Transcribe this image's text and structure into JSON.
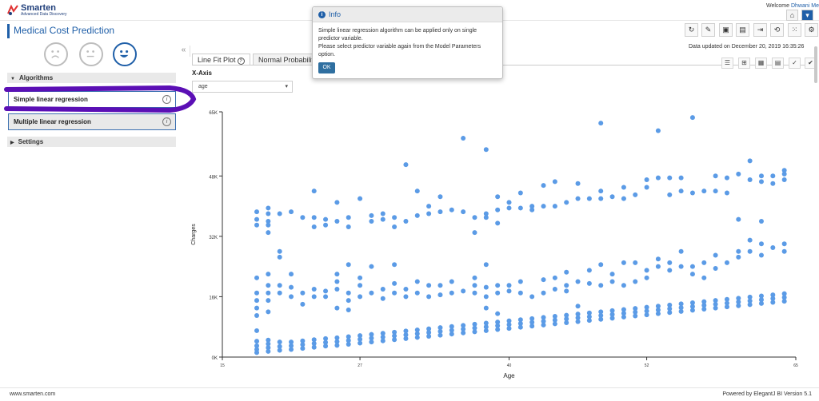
{
  "app": {
    "logo_name": "Smarten",
    "logo_sub": "Advanced Data Discovery",
    "welcome_prefix": "Welcome",
    "welcome_user": "Dhwani Me",
    "page_title": "Medical Cost Prediction",
    "updated": "Data updated on December 20, 2019 16:35:26"
  },
  "icons": {
    "home": "home-icon",
    "toolbar": [
      "refresh-icon",
      "tags-icon",
      "save-icon",
      "save-as-icon",
      "export-icon",
      "edit-icon",
      "time-icon",
      "grid-icon",
      "settings-icon"
    ],
    "mini": [
      "list-icon",
      "columns-icon",
      "table-icon",
      "table-rows-icon",
      "check-icon",
      "check-icon"
    ]
  },
  "sidebar": {
    "collapse_glyph": "«",
    "algorithms_header": "Algorithms",
    "algorithms": [
      "Simple linear regression",
      "Multiple linear regression"
    ],
    "settings_header": "Settings"
  },
  "tabs": [
    "Line Fit Plot",
    "Normal Probability"
  ],
  "controls": {
    "x_axis_label": "X-Axis",
    "x_axis_value": "age"
  },
  "modal": {
    "title": "Info",
    "line1": "Simple linear regression algorithm can be applied only on single predictor variable.",
    "line2": "Please select predictor variable again from the Model Parameters option.",
    "ok": "OK"
  },
  "footer": {
    "left": "www.smarten.com",
    "right": "Powered by ElegantJ BI Version 5.1"
  },
  "colors": {
    "accent": "#1f5fa8",
    "point": "#5b9be6",
    "annotation": "#5b0fb5"
  },
  "chart_data": {
    "type": "scatter",
    "xlabel": "Age",
    "ylabel": "Charges",
    "xlim": [
      15,
      65
    ],
    "ylim": [
      0,
      65000
    ],
    "x_ticks": [
      15,
      27,
      40,
      52,
      65
    ],
    "y_ticks": [
      0,
      16000,
      32000,
      48000,
      65000
    ],
    "x_tick_labels": [
      "15",
      "27",
      "40",
      "52",
      "65"
    ],
    "y_tick_labels": [
      "0K",
      "16K",
      "32K",
      "48K",
      "65K"
    ],
    "grid": false,
    "points": [
      [
        18,
        1200
      ],
      [
        18,
        2000
      ],
      [
        18,
        3000
      ],
      [
        18,
        4200
      ],
      [
        18,
        7000
      ],
      [
        18,
        11000
      ],
      [
        18,
        13000
      ],
      [
        18,
        15000
      ],
      [
        18,
        17000
      ],
      [
        18,
        21000
      ],
      [
        18,
        35000
      ],
      [
        18,
        36500
      ],
      [
        18,
        38500
      ],
      [
        19,
        1500
      ],
      [
        19,
        2500
      ],
      [
        19,
        3500
      ],
      [
        19,
        4500
      ],
      [
        19,
        12000
      ],
      [
        19,
        15000
      ],
      [
        19,
        17000
      ],
      [
        19,
        19000
      ],
      [
        19,
        22000
      ],
      [
        19,
        33000
      ],
      [
        19,
        35000
      ],
      [
        19,
        36000
      ],
      [
        19,
        38000
      ],
      [
        19,
        39500
      ],
      [
        20,
        1800
      ],
      [
        20,
        2800
      ],
      [
        20,
        4000
      ],
      [
        20,
        17000
      ],
      [
        20,
        19000
      ],
      [
        20,
        26500
      ],
      [
        20,
        28000
      ],
      [
        20,
        38000
      ],
      [
        21,
        2000
      ],
      [
        21,
        3000
      ],
      [
        21,
        4000
      ],
      [
        21,
        16000
      ],
      [
        21,
        18500
      ],
      [
        21,
        22000
      ],
      [
        21,
        38500
      ],
      [
        22,
        2300
      ],
      [
        22,
        3300
      ],
      [
        22,
        4300
      ],
      [
        22,
        14000
      ],
      [
        22,
        17000
      ],
      [
        22,
        37000
      ],
      [
        23,
        2600
      ],
      [
        23,
        3600
      ],
      [
        23,
        4600
      ],
      [
        23,
        16000
      ],
      [
        23,
        18000
      ],
      [
        23,
        34500
      ],
      [
        23,
        37000
      ],
      [
        23,
        44000
      ],
      [
        24,
        2900
      ],
      [
        24,
        3900
      ],
      [
        24,
        4900
      ],
      [
        24,
        16000
      ],
      [
        24,
        17500
      ],
      [
        24,
        35000
      ],
      [
        24,
        36500
      ],
      [
        25,
        3100
      ],
      [
        25,
        4100
      ],
      [
        25,
        5100
      ],
      [
        25,
        13000
      ],
      [
        25,
        18000
      ],
      [
        25,
        20000
      ],
      [
        25,
        22000
      ],
      [
        25,
        36000
      ],
      [
        25,
        41000
      ],
      [
        26,
        3400
      ],
      [
        26,
        4400
      ],
      [
        26,
        5400
      ],
      [
        26,
        12500
      ],
      [
        26,
        15000
      ],
      [
        26,
        17000
      ],
      [
        26,
        24500
      ],
      [
        26,
        34500
      ],
      [
        26,
        37000
      ],
      [
        27,
        3700
      ],
      [
        27,
        4700
      ],
      [
        27,
        5700
      ],
      [
        27,
        16000
      ],
      [
        27,
        19000
      ],
      [
        27,
        21000
      ],
      [
        27,
        42000
      ],
      [
        28,
        4000
      ],
      [
        28,
        5000
      ],
      [
        28,
        6000
      ],
      [
        28,
        17000
      ],
      [
        28,
        24000
      ],
      [
        28,
        36000
      ],
      [
        28,
        37500
      ],
      [
        29,
        4300
      ],
      [
        29,
        5300
      ],
      [
        29,
        6300
      ],
      [
        29,
        15500
      ],
      [
        29,
        18000
      ],
      [
        29,
        36500
      ],
      [
        29,
        38000
      ],
      [
        30,
        4600
      ],
      [
        30,
        5600
      ],
      [
        30,
        6600
      ],
      [
        30,
        17000
      ],
      [
        30,
        19500
      ],
      [
        30,
        24500
      ],
      [
        30,
        34500
      ],
      [
        30,
        37000
      ],
      [
        31,
        4900
      ],
      [
        31,
        5900
      ],
      [
        31,
        6900
      ],
      [
        31,
        16000
      ],
      [
        31,
        18000
      ],
      [
        31,
        51000
      ],
      [
        31,
        36000
      ],
      [
        32,
        5200
      ],
      [
        32,
        6200
      ],
      [
        32,
        7200
      ],
      [
        32,
        17000
      ],
      [
        32,
        20000
      ],
      [
        32,
        44000
      ],
      [
        32,
        37500
      ],
      [
        33,
        5500
      ],
      [
        33,
        6500
      ],
      [
        33,
        7500
      ],
      [
        33,
        16000
      ],
      [
        33,
        19000
      ],
      [
        33,
        38000
      ],
      [
        33,
        40000
      ],
      [
        34,
        5800
      ],
      [
        34,
        6800
      ],
      [
        34,
        7800
      ],
      [
        34,
        16500
      ],
      [
        34,
        19000
      ],
      [
        34,
        38500
      ],
      [
        34,
        42500
      ],
      [
        35,
        6100
      ],
      [
        35,
        7100
      ],
      [
        35,
        8100
      ],
      [
        35,
        17000
      ],
      [
        35,
        20000
      ],
      [
        35,
        39000
      ],
      [
        36,
        6400
      ],
      [
        36,
        7400
      ],
      [
        36,
        8400
      ],
      [
        36,
        17500
      ],
      [
        36,
        58000
      ],
      [
        36,
        38500
      ],
      [
        37,
        6700
      ],
      [
        37,
        7700
      ],
      [
        37,
        8700
      ],
      [
        37,
        17000
      ],
      [
        37,
        19000
      ],
      [
        37,
        21000
      ],
      [
        37,
        33000
      ],
      [
        37,
        37000
      ],
      [
        38,
        7000
      ],
      [
        38,
        8000
      ],
      [
        38,
        9000
      ],
      [
        38,
        13000
      ],
      [
        38,
        16000
      ],
      [
        38,
        18500
      ],
      [
        38,
        24500
      ],
      [
        38,
        37000
      ],
      [
        38,
        38000
      ],
      [
        38,
        55000
      ],
      [
        39,
        7300
      ],
      [
        39,
        8300
      ],
      [
        39,
        9300
      ],
      [
        39,
        11500
      ],
      [
        39,
        17000
      ],
      [
        39,
        19000
      ],
      [
        39,
        35500
      ],
      [
        39,
        39000
      ],
      [
        39,
        42500
      ],
      [
        40,
        7600
      ],
      [
        40,
        8600
      ],
      [
        40,
        9600
      ],
      [
        40,
        17500
      ],
      [
        40,
        19000
      ],
      [
        40,
        39500
      ],
      [
        40,
        41000
      ],
      [
        41,
        7900
      ],
      [
        41,
        8900
      ],
      [
        41,
        9900
      ],
      [
        41,
        17000
      ],
      [
        41,
        20000
      ],
      [
        41,
        39500
      ],
      [
        41,
        43500
      ],
      [
        42,
        8200
      ],
      [
        42,
        9200
      ],
      [
        42,
        10200
      ],
      [
        42,
        16000
      ],
      [
        42,
        39000
      ],
      [
        42,
        40000
      ],
      [
        43,
        8500
      ],
      [
        43,
        9500
      ],
      [
        43,
        10500
      ],
      [
        43,
        17000
      ],
      [
        43,
        20500
      ],
      [
        43,
        40000
      ],
      [
        43,
        45500
      ],
      [
        44,
        8800
      ],
      [
        44,
        9800
      ],
      [
        44,
        10800
      ],
      [
        44,
        18000
      ],
      [
        44,
        21000
      ],
      [
        44,
        40000
      ],
      [
        44,
        46500
      ],
      [
        45,
        9100
      ],
      [
        45,
        10100
      ],
      [
        45,
        11100
      ],
      [
        45,
        17500
      ],
      [
        45,
        19000
      ],
      [
        45,
        22500
      ],
      [
        45,
        41000
      ],
      [
        46,
        9400
      ],
      [
        46,
        10400
      ],
      [
        46,
        11400
      ],
      [
        46,
        13500
      ],
      [
        46,
        20000
      ],
      [
        46,
        42000
      ],
      [
        46,
        46000
      ],
      [
        47,
        9700
      ],
      [
        47,
        10700
      ],
      [
        47,
        11700
      ],
      [
        47,
        19500
      ],
      [
        47,
        23000
      ],
      [
        47,
        42000
      ],
      [
        48,
        10000
      ],
      [
        48,
        11000
      ],
      [
        48,
        12000
      ],
      [
        48,
        19000
      ],
      [
        48,
        24500
      ],
      [
        48,
        42000
      ],
      [
        48,
        44000
      ],
      [
        48,
        62000
      ],
      [
        49,
        10300
      ],
      [
        49,
        11300
      ],
      [
        49,
        12300
      ],
      [
        49,
        20000
      ],
      [
        49,
        22000
      ],
      [
        49,
        42500
      ],
      [
        50,
        10600
      ],
      [
        50,
        11600
      ],
      [
        50,
        12600
      ],
      [
        50,
        19000
      ],
      [
        50,
        25000
      ],
      [
        50,
        42000
      ],
      [
        50,
        45000
      ],
      [
        51,
        10900
      ],
      [
        51,
        11900
      ],
      [
        51,
        12900
      ],
      [
        51,
        20000
      ],
      [
        51,
        25000
      ],
      [
        51,
        43000
      ],
      [
        52,
        11200
      ],
      [
        52,
        12200
      ],
      [
        52,
        13200
      ],
      [
        52,
        21000
      ],
      [
        52,
        23000
      ],
      [
        52,
        45000
      ],
      [
        52,
        47000
      ],
      [
        53,
        11500
      ],
      [
        53,
        12500
      ],
      [
        53,
        13500
      ],
      [
        53,
        24000
      ],
      [
        53,
        26000
      ],
      [
        53,
        47500
      ],
      [
        53,
        60000
      ],
      [
        54,
        11800
      ],
      [
        54,
        12800
      ],
      [
        54,
        13800
      ],
      [
        54,
        23000
      ],
      [
        54,
        25000
      ],
      [
        54,
        43000
      ],
      [
        54,
        47500
      ],
      [
        55,
        12100
      ],
      [
        55,
        13100
      ],
      [
        55,
        14100
      ],
      [
        55,
        24000
      ],
      [
        55,
        28000
      ],
      [
        55,
        44000
      ],
      [
        55,
        47500
      ],
      [
        56,
        12400
      ],
      [
        56,
        13400
      ],
      [
        56,
        14400
      ],
      [
        56,
        22000
      ],
      [
        56,
        24000
      ],
      [
        56,
        43500
      ],
      [
        56,
        63500
      ],
      [
        57,
        12700
      ],
      [
        57,
        13700
      ],
      [
        57,
        14700
      ],
      [
        57,
        21000
      ],
      [
        57,
        25000
      ],
      [
        57,
        44000
      ],
      [
        58,
        13000
      ],
      [
        58,
        14000
      ],
      [
        58,
        15000
      ],
      [
        58,
        23500
      ],
      [
        58,
        27000
      ],
      [
        58,
        44000
      ],
      [
        58,
        48000
      ],
      [
        59,
        13300
      ],
      [
        59,
        14300
      ],
      [
        59,
        15300
      ],
      [
        59,
        25000
      ],
      [
        59,
        43500
      ],
      [
        59,
        47500
      ],
      [
        60,
        13600
      ],
      [
        60,
        14600
      ],
      [
        60,
        15600
      ],
      [
        60,
        26500
      ],
      [
        60,
        28000
      ],
      [
        60,
        36500
      ],
      [
        60,
        48500
      ],
      [
        61,
        13900
      ],
      [
        61,
        14900
      ],
      [
        61,
        15900
      ],
      [
        61,
        28000
      ],
      [
        61,
        31000
      ],
      [
        61,
        47000
      ],
      [
        61,
        52000
      ],
      [
        62,
        14200
      ],
      [
        62,
        15200
      ],
      [
        62,
        16200
      ],
      [
        62,
        27000
      ],
      [
        62,
        30000
      ],
      [
        62,
        36000
      ],
      [
        62,
        46500
      ],
      [
        62,
        48000
      ],
      [
        63,
        14500
      ],
      [
        63,
        15500
      ],
      [
        63,
        16500
      ],
      [
        63,
        29000
      ],
      [
        63,
        46000
      ],
      [
        63,
        48000
      ],
      [
        64,
        14800
      ],
      [
        64,
        15800
      ],
      [
        64,
        16800
      ],
      [
        64,
        28000
      ],
      [
        64,
        30000
      ],
      [
        64,
        47000
      ],
      [
        64,
        48500
      ],
      [
        64,
        49500
      ]
    ]
  }
}
